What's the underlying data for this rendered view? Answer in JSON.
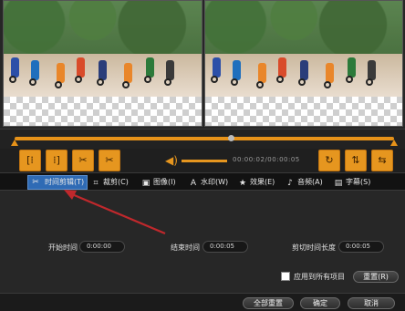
{
  "controls": {
    "buttons": [
      {
        "name": "mark-in-button",
        "icon": "mark-in-icon",
        "glyph": "[⁞"
      },
      {
        "name": "mark-out-button",
        "icon": "mark-out-icon",
        "glyph": "⁞]"
      },
      {
        "name": "cut-left-button",
        "icon": "scissors-left-icon",
        "glyph": "✂"
      },
      {
        "name": "cut-right-button",
        "icon": "scissors-right-icon",
        "glyph": "✂"
      }
    ],
    "volume_icon": "speaker-icon",
    "time": "00:00:02/00:00:05",
    "right_buttons": [
      {
        "name": "rotate-button",
        "icon": "rotate-icon",
        "glyph": "↻"
      },
      {
        "name": "flip-vertical-button",
        "icon": "flip-vertical-icon",
        "glyph": "⇅"
      },
      {
        "name": "flip-horizontal-button",
        "icon": "flip-horizontal-icon",
        "glyph": "⇆"
      }
    ]
  },
  "tabs": [
    {
      "label": "时间剪辑(T)",
      "icon": "scissors-icon",
      "active": true
    },
    {
      "label": "裁剪(C)",
      "icon": "crop-icon",
      "active": false
    },
    {
      "label": "图像(I)",
      "icon": "image-icon",
      "active": false
    },
    {
      "label": "水印(W)",
      "icon": "watermark-icon",
      "active": false
    },
    {
      "label": "效果(E)",
      "icon": "star-icon",
      "active": false
    },
    {
      "label": "音频(A)",
      "icon": "music-note-icon",
      "active": false
    },
    {
      "label": "字幕(S)",
      "icon": "subtitle-icon",
      "active": false
    }
  ],
  "trim": {
    "start_label": "开始时间",
    "start_value": "0:00:00",
    "end_label": "结束时间",
    "end_value": "0:00:05",
    "length_label": "剪切时间长度",
    "length_value": "0:00:05",
    "apply_all_label": "应用到所有项目",
    "reset_label": "重置(R)"
  },
  "footer": {
    "reset_all_label": "全部重置",
    "ok_label": "确定",
    "cancel_label": "取消"
  },
  "colors": {
    "accent": "#e6961f",
    "active_tab": "#2f6bb5",
    "annotation_arrow": "#c0282c"
  }
}
